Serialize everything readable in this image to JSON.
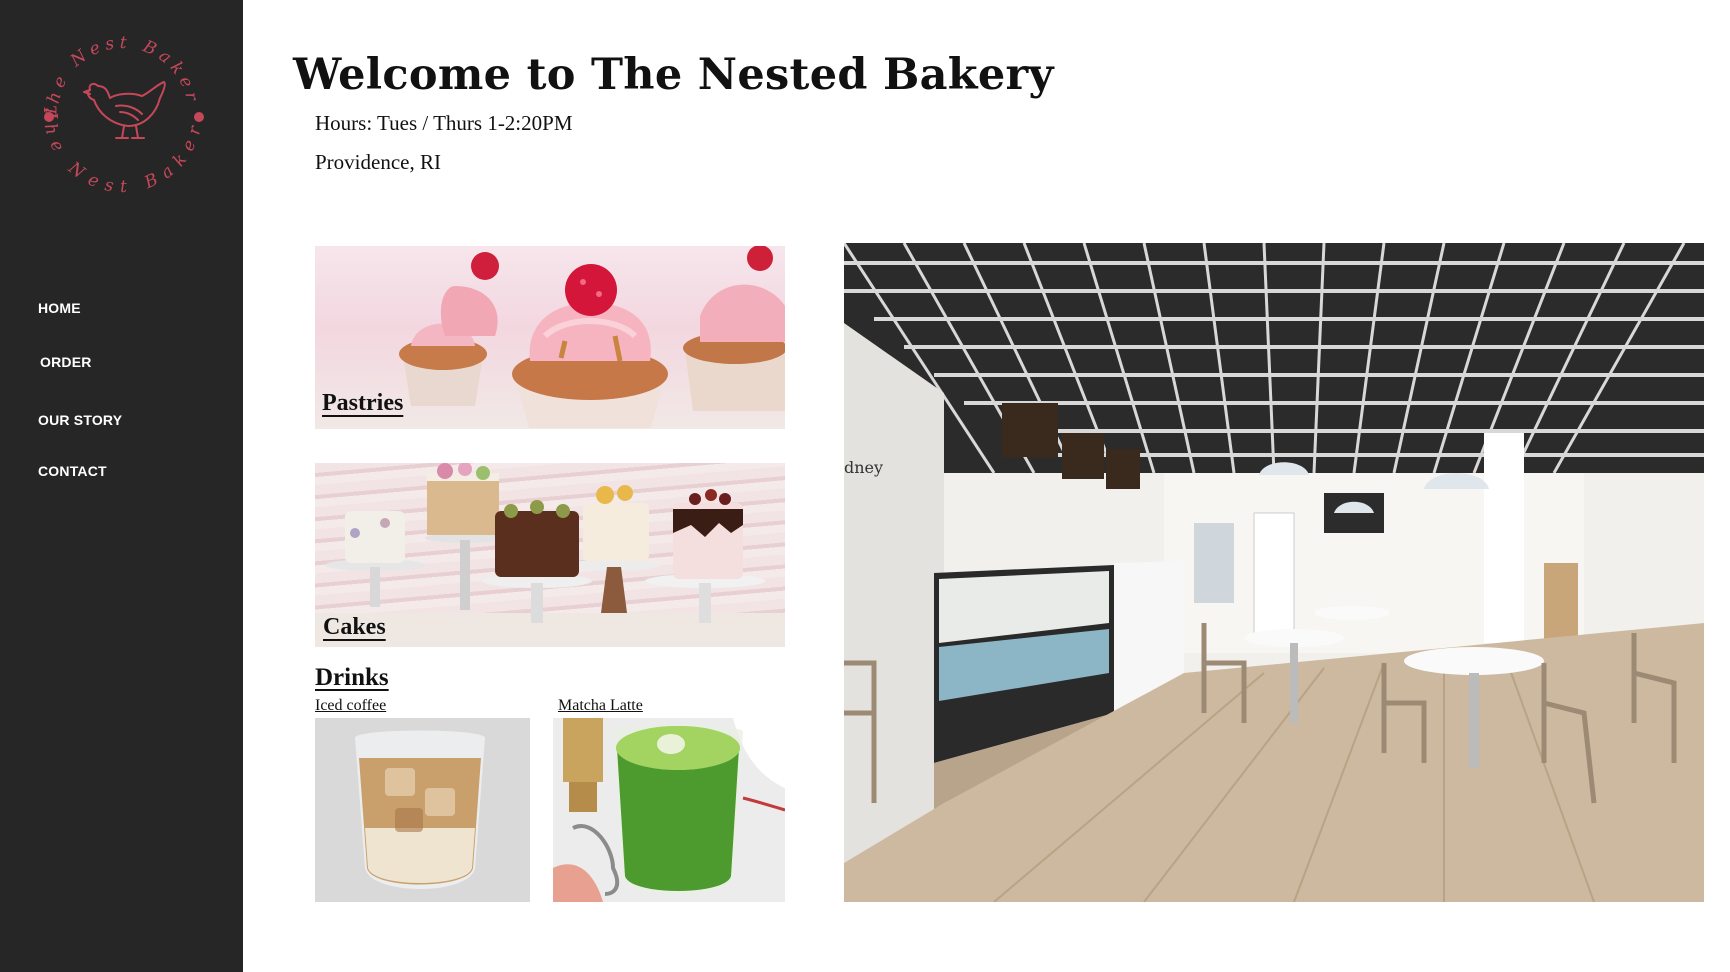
{
  "brand": {
    "logo_text_top": "The Nest Bakery",
    "logo_text_bottom": "The Nest Bakery",
    "logo_icon": "hen-icon",
    "accent_color": "#c4485a",
    "sidebar_color": "#262626"
  },
  "nav": {
    "items": [
      {
        "label": "HOME"
      },
      {
        "label": "ORDER"
      },
      {
        "label": "OUR STORY"
      },
      {
        "label": "CONTACT"
      }
    ]
  },
  "header": {
    "title": "Welcome to The Nested Bakery",
    "hours": "Hours: Tues / Thurs 1-2:20PM",
    "location": "Providence, RI"
  },
  "categories": {
    "pastries_label": "Pastries",
    "cakes_label": "Cakes",
    "drinks_title": "Drinks",
    "drinks": [
      {
        "label": "Iced coffee"
      },
      {
        "label": "Matcha Latte"
      }
    ]
  },
  "photo": {
    "wall_sign_text": "dney"
  }
}
